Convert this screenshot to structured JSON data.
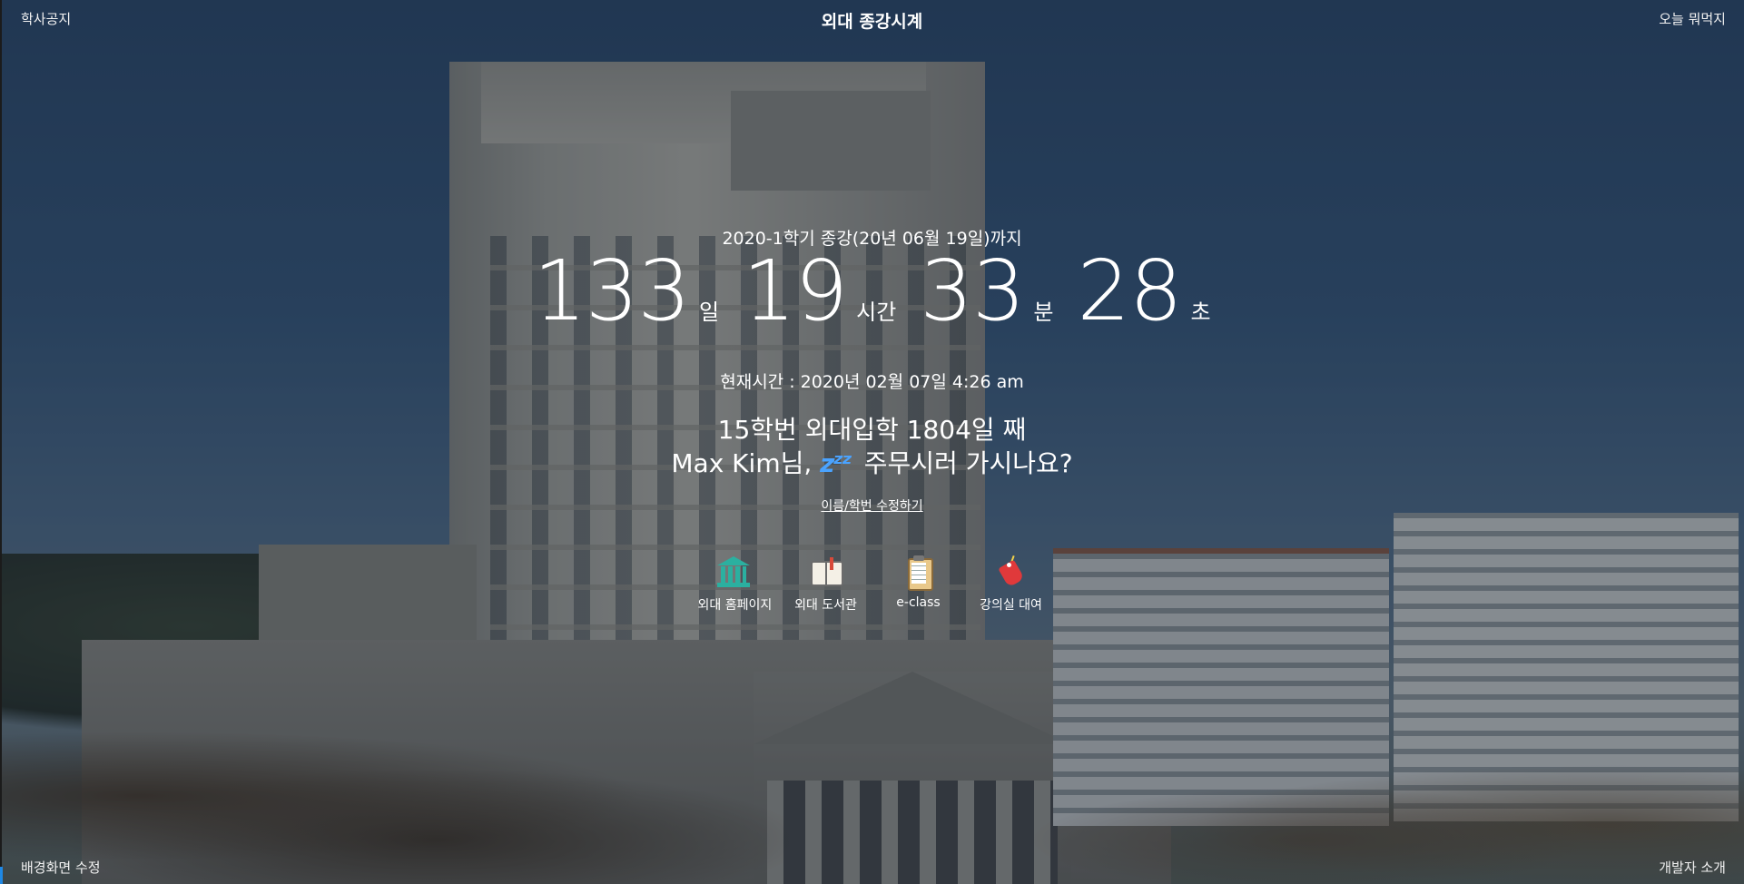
{
  "header": {
    "title": "외대 종강시계",
    "left_link": "학사공지",
    "right_link": "오늘 뭐먹지"
  },
  "footer": {
    "left_link": "배경화면 수정",
    "right_link": "개발자 소개"
  },
  "countdown": {
    "deadline_text": "2020-1학기 종강(20년 06월 19일)까지",
    "days": "133",
    "days_unit": "일",
    "hours": "19",
    "hours_unit": "시간",
    "minutes": "33",
    "minutes_unit": "분",
    "seconds": "28",
    "seconds_unit": "초"
  },
  "current_time": "현재시간 : 2020년 02월 07일 4:26 am",
  "greeting": {
    "line1": "15학번 외대입학 1804일 째",
    "line2_prefix": "Max Kim님,",
    "line2_icon": "sleeping-zzz-icon",
    "line2_suffix": "주무시러 가시나요?"
  },
  "edit_link": "이름/학번 수정하기",
  "shortcuts": [
    {
      "label": "외대 홈페이지",
      "icon": "university-building-icon"
    },
    {
      "label": "외대 도서관",
      "icon": "open-book-icon"
    },
    {
      "label": "e-class",
      "icon": "clipboard-icon"
    },
    {
      "label": "강의실 대여",
      "icon": "tag-icon"
    }
  ],
  "colors": {
    "text": "#ffffff",
    "accent_zzz": "#4aa3ff",
    "overlay": "rgba(10,20,35,0.38)"
  }
}
